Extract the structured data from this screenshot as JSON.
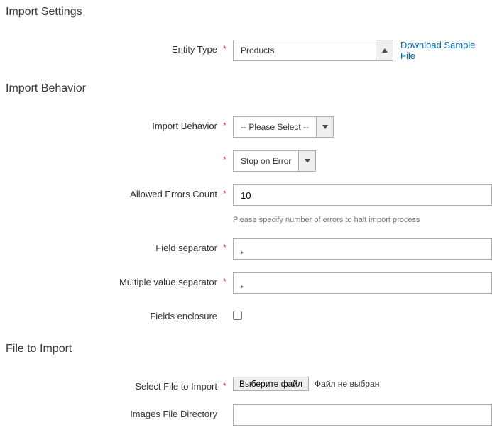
{
  "sections": {
    "import_settings": "Import Settings",
    "import_behavior": "Import Behavior",
    "file_to_import": "File to Import"
  },
  "labels": {
    "entity_type": "Entity Type",
    "download_sample": "Download Sample File",
    "import_behavior": "Import Behavior",
    "allowed_errors": "Allowed Errors Count",
    "allowed_errors_note": "Please specify number of errors to halt import process",
    "field_separator": "Field separator",
    "multi_separator": "Multiple value separator",
    "fields_enclosure": "Fields enclosure",
    "select_file": "Select File to Import",
    "images_dir": "Images File Directory"
  },
  "values": {
    "entity_type": "Products",
    "import_behavior": "-- Please Select --",
    "validation_strategy": "Stop on Error",
    "allowed_errors": "10",
    "field_separator": ",",
    "multi_separator": ",",
    "file_button": "Выберите файл",
    "file_status": "Файл не выбран",
    "images_dir": ""
  },
  "required_marker": "*"
}
